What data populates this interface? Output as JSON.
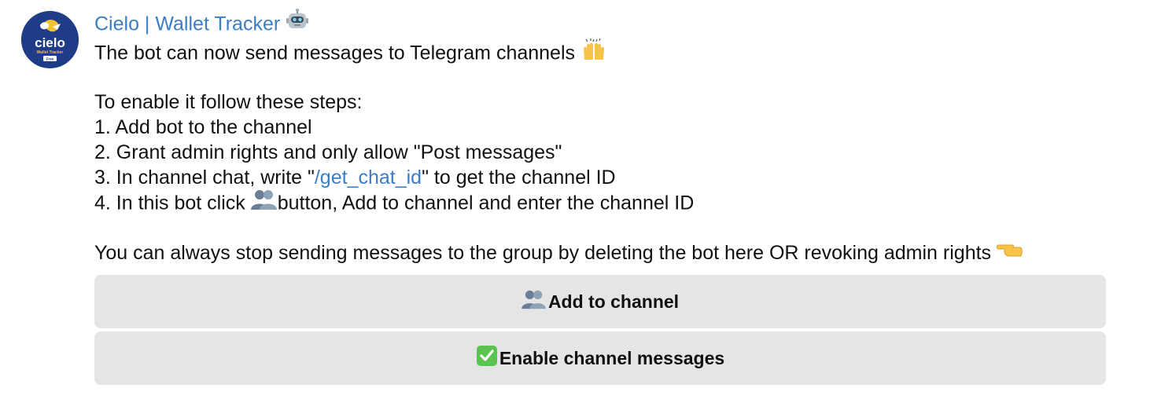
{
  "sender": {
    "name": "Cielo | Wallet Tracker",
    "emoji": "robot-icon"
  },
  "avatar": {
    "brand": "cielo",
    "subtitle": "Wallet Tracker",
    "badge": "Free",
    "bg_color": "#1f3d86",
    "accent_color": "#f2c230"
  },
  "message": {
    "line1": "The bot can now send messages to Telegram channels",
    "line2": "To enable it follow these steps:",
    "step1": "1. Add bot to the channel",
    "step2": "2. Grant admin rights and only allow \"Post messages\"",
    "step3_before": "3. In channel chat, write \"",
    "step3_link": "/get_chat_id",
    "step3_after": "\" to get the channel ID",
    "step4_before": "4. In this bot click ",
    "step4_after": "button, Add to channel and enter the channel ID",
    "footer": "You can always stop sending messages to the group by deleting the bot here OR revoking admin rights"
  },
  "buttons": [
    {
      "label": "Add to channel",
      "icon": "people-icon"
    },
    {
      "label": "Enable channel messages",
      "icon": "check-mark-icon"
    }
  ],
  "colors": {
    "link": "#3b7dc6",
    "button_bg": "#e5e5e5"
  }
}
